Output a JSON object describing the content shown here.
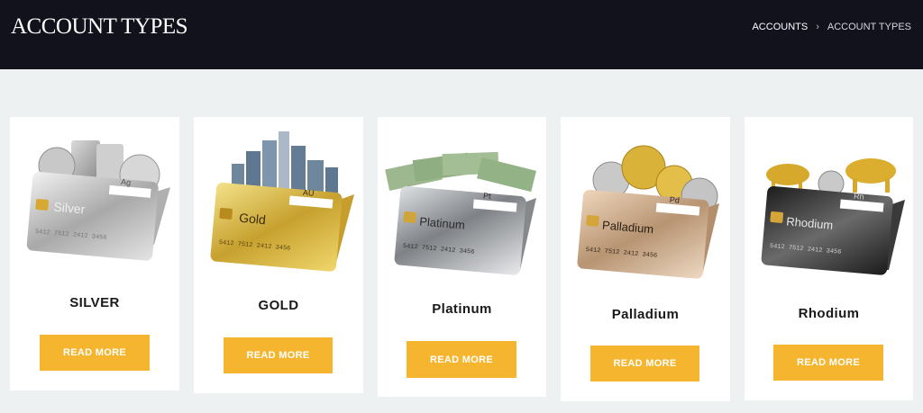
{
  "header": {
    "title": "ACCOUNT TYPES",
    "breadcrumb": {
      "link": "ACCOUNTS",
      "separator": "›",
      "current": "ACCOUNT TYPES"
    }
  },
  "cards": [
    {
      "title": "SILVER",
      "button": "READ MORE",
      "card_label": "Silver",
      "symbol": "Ag",
      "number": "5412 7512 2412 3456"
    },
    {
      "title": "GOLD",
      "button": "READ MORE",
      "card_label": "Gold",
      "symbol": "AU",
      "number": "5412 7512 2412 3456"
    },
    {
      "title": "Platinum",
      "button": "READ MORE",
      "card_label": "Platinum",
      "symbol": "Pt",
      "number": "5412 7512 2412 3456"
    },
    {
      "title": "Palladium",
      "button": "READ MORE",
      "card_label": "Palladium",
      "symbol": "Pd",
      "number": "5412 7512 2412 3456"
    },
    {
      "title": "Rhodium",
      "button": "READ MORE",
      "card_label": "Rhodium",
      "symbol": "Rh",
      "number": "5412 7512 2412 3456"
    }
  ],
  "colors": {
    "header_bg": "#12121d",
    "page_bg": "#eef1f2",
    "button": "#f5b52e"
  }
}
